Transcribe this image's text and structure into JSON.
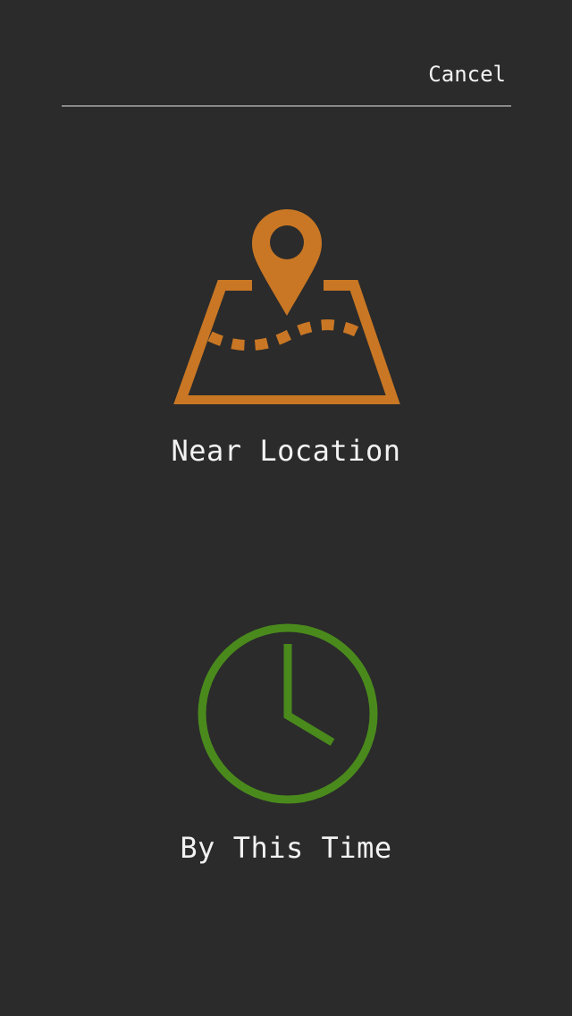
{
  "header": {
    "cancel_label": "Cancel"
  },
  "options": {
    "location": {
      "label": "Near Location",
      "icon": "map-pin-icon",
      "color": "#c97724"
    },
    "time": {
      "label": "By This Time",
      "icon": "clock-icon",
      "color": "#4a8a1c"
    }
  },
  "colors": {
    "background": "#2b2b2b",
    "text": "#f2f2f2",
    "divider": "#e6e6e6"
  }
}
